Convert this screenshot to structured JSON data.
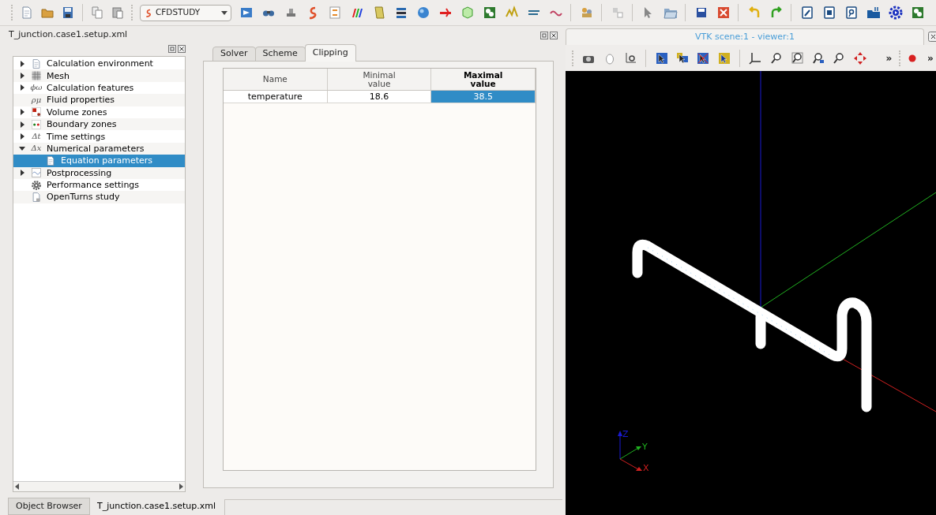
{
  "toolbar": {
    "combo": "CFDSTUDY"
  },
  "dock_title": "T_junction.case1.setup.xml",
  "tree": [
    {
      "label": "Calculation environment",
      "expanded": false,
      "selected": false
    },
    {
      "label": "Mesh",
      "expanded": false,
      "selected": false
    },
    {
      "label": "Calculation features",
      "glyph": "ϕω",
      "expanded": false,
      "selected": false
    },
    {
      "label": "Fluid properties",
      "glyph": "ρμ",
      "selected": false
    },
    {
      "label": "Volume zones",
      "expanded": false,
      "selected": false
    },
    {
      "label": "Boundary zones",
      "expanded": false,
      "selected": false
    },
    {
      "label": "Time settings",
      "glyph": "Δt",
      "expanded": false,
      "selected": false
    },
    {
      "label": "Numerical parameters",
      "glyph": "Δx",
      "expanded": true,
      "selected": false,
      "children": [
        {
          "label": "Equation parameters",
          "selected": true
        }
      ]
    },
    {
      "label": "Postprocessing",
      "expanded": false,
      "selected": false
    },
    {
      "label": "Performance settings",
      "selected": false
    },
    {
      "label": "OpenTurns study",
      "selected": false
    }
  ],
  "tabs": [
    {
      "label": "Solver",
      "selected": false
    },
    {
      "label": "Scheme",
      "selected": false
    },
    {
      "label": "Clipping",
      "selected": true
    }
  ],
  "table": {
    "columns": [
      {
        "label": "Name",
        "current": false
      },
      {
        "label": "Minimal value",
        "current": false
      },
      {
        "label": "Maximal value",
        "current": true
      }
    ],
    "rows": [
      {
        "cells": [
          {
            "text": "temperature",
            "selected": false
          },
          {
            "text": "18.6",
            "selected": false
          },
          {
            "text": "38.5",
            "selected": true
          }
        ]
      }
    ]
  },
  "bottom_tabs": [
    {
      "label": "Object Browser",
      "selected": false
    },
    {
      "label": "T_junction.case1.setup.xml",
      "selected": true
    }
  ],
  "viewer": {
    "title": "VTK scene:1 - viewer:1",
    "overflow": [
      "»",
      "»"
    ],
    "axis_labels": [
      "Z",
      "Y",
      "X"
    ]
  }
}
